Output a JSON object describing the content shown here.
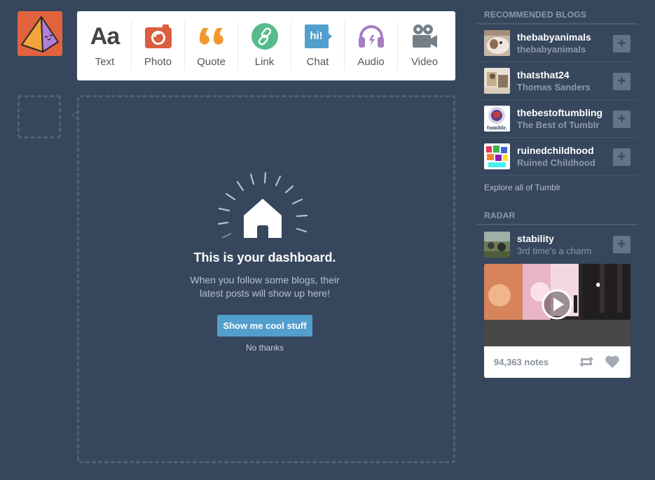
{
  "post_types": [
    {
      "label": "Text",
      "icon": "text-icon",
      "glyph": "Aa",
      "color": "#444444"
    },
    {
      "label": "Photo",
      "icon": "camera-icon",
      "color": "#d95e40"
    },
    {
      "label": "Quote",
      "icon": "quote-icon",
      "color": "#f2992e"
    },
    {
      "label": "Link",
      "icon": "link-icon",
      "color": "#56bc8a"
    },
    {
      "label": "Chat",
      "icon": "chat-icon",
      "glyph": "hi!",
      "color": "#529ecc"
    },
    {
      "label": "Audio",
      "icon": "headphones-icon",
      "color": "#a77dc2"
    },
    {
      "label": "Video",
      "icon": "video-camera-icon",
      "color": "#748089"
    }
  ],
  "dashboard": {
    "title": "This is your dashboard.",
    "message_line1": "When you follow some blogs, their",
    "message_line2": "latest posts will show up here!",
    "cta": "Show me cool stuff",
    "dismiss": "No thanks"
  },
  "sidebar": {
    "recommended_title": "RECOMMENDED BLOGS",
    "blogs": [
      {
        "name": "thebabyanimals",
        "title": "thebabyanimals"
      },
      {
        "name": "thatsthat24",
        "title": "Thomas Sanders"
      },
      {
        "name": "thebestoftumbling",
        "title": "The Best of Tumblr"
      },
      {
        "name": "ruinedchildhood",
        "title": "Ruined Childhood"
      }
    ],
    "explore": "Explore all of Tumblr",
    "radar_title": "RADAR",
    "radar": {
      "name": "stability",
      "title": "3rd time's a charm",
      "notes": "94,363 notes"
    },
    "thumb_badge": "tumblr."
  },
  "colors": {
    "background": "#36465d",
    "accent": "#529ecc",
    "avatar": "#e0633d"
  }
}
